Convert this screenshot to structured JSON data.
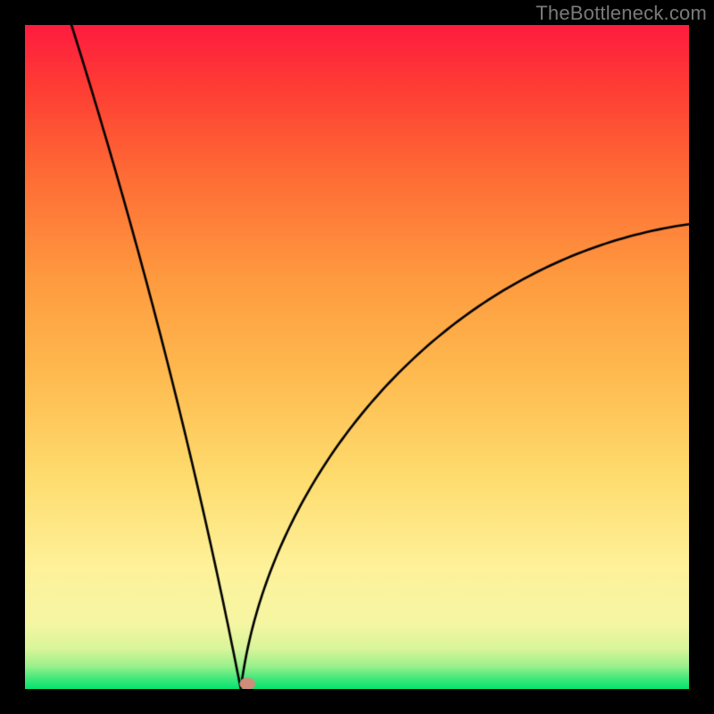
{
  "watermark": "TheBottleneck.com",
  "chart_data": {
    "type": "line",
    "title": "",
    "xlabel": "",
    "ylabel": "",
    "xlim": [
      0,
      1
    ],
    "ylim": [
      0,
      1
    ],
    "background_gradient": {
      "stops": [
        {
          "pos": 0.0,
          "color": "#04e36f"
        },
        {
          "pos": 0.015,
          "color": "#3de87a"
        },
        {
          "pos": 0.035,
          "color": "#9cf18c"
        },
        {
          "pos": 0.06,
          "color": "#d8f59a"
        },
        {
          "pos": 0.1,
          "color": "#f6f6a3"
        },
        {
          "pos": 0.18,
          "color": "#fef29b"
        },
        {
          "pos": 0.32,
          "color": "#fedc6e"
        },
        {
          "pos": 0.48,
          "color": "#feb94e"
        },
        {
          "pos": 0.62,
          "color": "#fe9a3f"
        },
        {
          "pos": 0.78,
          "color": "#fe6a35"
        },
        {
          "pos": 0.9,
          "color": "#fe3f34"
        },
        {
          "pos": 1.0,
          "color": "#fe1c3f"
        }
      ]
    },
    "curve": {
      "description": "V-shaped bottleneck curve: steep near-linear descent on the left, cusp near the bottom, then concave rise to the right",
      "min_x": 0.325,
      "min_y": 0.0,
      "left_top": {
        "x": 0.07,
        "y": 1.0
      },
      "right_end": {
        "x": 1.0,
        "y": 0.7
      },
      "left_branch_curvature": 0.06,
      "right_branch_curvature": 0.55
    },
    "marker": {
      "x": 0.335,
      "y": 0.008,
      "rx": 0.012,
      "ry": 0.009,
      "color": "#cf8d7c"
    },
    "stroke": {
      "color": "#000000",
      "width": 2.6
    }
  }
}
